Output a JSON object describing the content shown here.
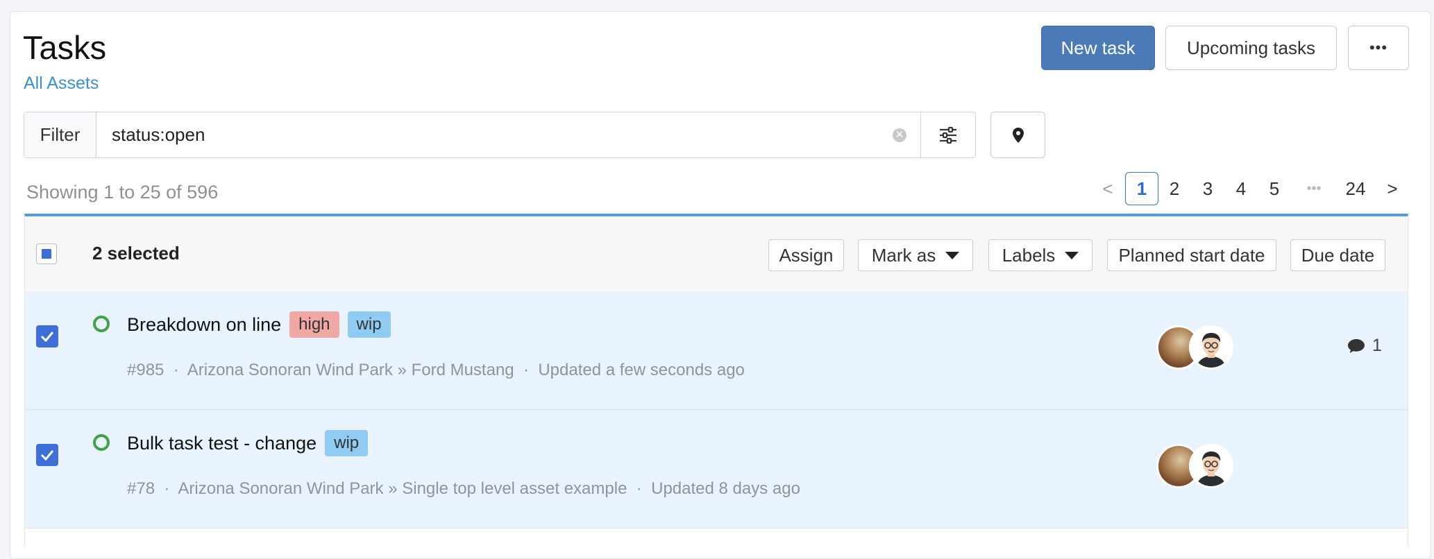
{
  "header": {
    "title": "Tasks",
    "breadcrumb": "All Assets",
    "new_task_label": "New task",
    "upcoming_label": "Upcoming tasks",
    "more_label": "•••"
  },
  "filter": {
    "label": "Filter",
    "value": "status:open"
  },
  "results": {
    "showing": "Showing 1 to 25 of 596"
  },
  "pagination": {
    "prev": "<",
    "pages": [
      "1",
      "2",
      "3",
      "4",
      "5"
    ],
    "ellipsis": "•••",
    "last": "24",
    "next": ">",
    "active": "1"
  },
  "bulk": {
    "selected": "2 selected",
    "assign": "Assign",
    "mark_as": "Mark as",
    "labels": "Labels",
    "planned_start": "Planned start date",
    "due_date": "Due date"
  },
  "tasks": [
    {
      "title": "Breakdown on line",
      "tags": [
        "high",
        "wip"
      ],
      "id": "#985",
      "location": "Arizona Sonoran Wind Park » Ford Mustang",
      "updated": "Updated a few seconds ago",
      "comments": "1",
      "checked": true
    },
    {
      "title": "Bulk task test - change",
      "tags": [
        "wip"
      ],
      "id": "#78",
      "location": "Arizona Sonoran Wind Park » Single top level asset example",
      "updated": "Updated 8 days ago",
      "checked": true
    }
  ],
  "meta_separator": "·",
  "colors": {
    "primary": "#4a7bb8",
    "link": "#3a8fd1",
    "checkbox": "#3d6fd9",
    "row_selected": "#e9f3fd",
    "tag_high": "#f1a7a4",
    "tag_wip": "#8fcbf3",
    "status_open": "#3fa14a"
  },
  "icons": {
    "filter_settings": "sliders-icon",
    "location": "map-pin-icon",
    "comment": "comment-icon",
    "clear": "clear-icon",
    "status": "open-circle-icon"
  }
}
